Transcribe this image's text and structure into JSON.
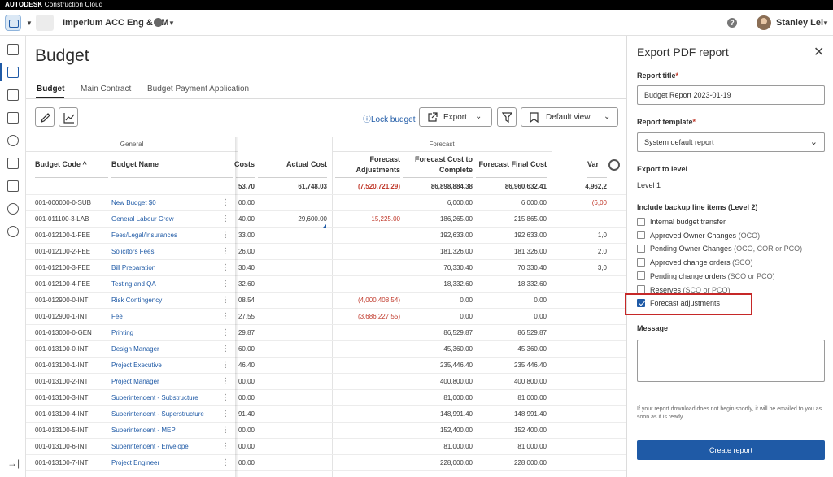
{
  "brand": {
    "name": "AUTODESK",
    "product": "Construction Cloud"
  },
  "header": {
    "project_name": "Imperium ACC Eng & PM",
    "user_name": "Stanley Lei",
    "help": "?"
  },
  "page": {
    "title": "Budget"
  },
  "tabs": [
    "Budget",
    "Main Contract",
    "Budget Payment Application"
  ],
  "toolbar": {
    "lock_budget": "Lock budget",
    "export": "Export",
    "view": "Default view"
  },
  "table": {
    "groups": {
      "general": "General",
      "forecast": "Forecast"
    },
    "columns": {
      "code": "Budget Code",
      "name": "Budget Name",
      "costs": "Costs",
      "actual": "Actual Cost",
      "fc_adj": "Forecast Adjustments",
      "fc_complete": "Forecast Cost to Complete",
      "fc_final": "Forecast Final Cost",
      "var": "Var"
    },
    "totals": {
      "costs": "53.70",
      "actual": "61,748.03",
      "fc_adj": "(7,520,721.29)",
      "fc_complete": "86,898,884.38",
      "fc_final": "86,960,632.41",
      "var": "4,962,2"
    },
    "rows": [
      {
        "code": "001-000000-0-SUB",
        "name": "New Budget $0",
        "costs": "00.00",
        "actual": "",
        "fc_adj": "",
        "fc_complete": "6,000.00",
        "fc_final": "6,000.00",
        "var": "(6,00"
      },
      {
        "code": "001-011100-3-LAB",
        "name": "General Labour Crew",
        "costs": "40.00",
        "actual": "29,600.00",
        "fc_adj": "15,225.00",
        "fc_complete": "186,265.00",
        "fc_final": "215,865.00",
        "var": ""
      },
      {
        "code": "001-012100-1-FEE",
        "name": "Fees/Legal/Insurances",
        "costs": "33.00",
        "actual": "",
        "fc_adj": "",
        "fc_complete": "192,633.00",
        "fc_final": "192,633.00",
        "var": "1,0"
      },
      {
        "code": "001-012100-2-FEE",
        "name": "Solicitors Fees",
        "costs": "26.00",
        "actual": "",
        "fc_adj": "",
        "fc_complete": "181,326.00",
        "fc_final": "181,326.00",
        "var": "2,0"
      },
      {
        "code": "001-012100-3-FEE",
        "name": "Bill Preparation",
        "costs": "30.40",
        "actual": "",
        "fc_adj": "",
        "fc_complete": "70,330.40",
        "fc_final": "70,330.40",
        "var": "3,0"
      },
      {
        "code": "001-012100-4-FEE",
        "name": "Testing and QA",
        "costs": "32.60",
        "actual": "",
        "fc_adj": "",
        "fc_complete": "18,332.60",
        "fc_final": "18,332.60",
        "var": ""
      },
      {
        "code": "001-012900-0-INT",
        "name": "Risk Contingency",
        "costs": "08.54",
        "actual": "",
        "fc_adj": "(4,000,408.54)",
        "fc_complete": "0.00",
        "fc_final": "0.00",
        "var": ""
      },
      {
        "code": "001-012900-1-INT",
        "name": "Fee",
        "costs": "27.55",
        "actual": "",
        "fc_adj": "(3,686,227.55)",
        "fc_complete": "0.00",
        "fc_final": "0.00",
        "var": ""
      },
      {
        "code": "001-013000-0-GEN",
        "name": "Printing",
        "costs": "29.87",
        "actual": "",
        "fc_adj": "",
        "fc_complete": "86,529.87",
        "fc_final": "86,529.87",
        "var": ""
      },
      {
        "code": "001-013100-0-INT",
        "name": "Design Manager",
        "costs": "60.00",
        "actual": "",
        "fc_adj": "",
        "fc_complete": "45,360.00",
        "fc_final": "45,360.00",
        "var": ""
      },
      {
        "code": "001-013100-1-INT",
        "name": "Project Executive",
        "costs": "46.40",
        "actual": "",
        "fc_adj": "",
        "fc_complete": "235,446.40",
        "fc_final": "235,446.40",
        "var": ""
      },
      {
        "code": "001-013100-2-INT",
        "name": "Project Manager",
        "costs": "00.00",
        "actual": "",
        "fc_adj": "",
        "fc_complete": "400,800.00",
        "fc_final": "400,800.00",
        "var": ""
      },
      {
        "code": "001-013100-3-INT",
        "name": "Superintendent - Substructure",
        "costs": "00.00",
        "actual": "",
        "fc_adj": "",
        "fc_complete": "81,000.00",
        "fc_final": "81,000.00",
        "var": ""
      },
      {
        "code": "001-013100-4-INT",
        "name": "Superintendent - Superstructure",
        "costs": "91.40",
        "actual": "",
        "fc_adj": "",
        "fc_complete": "148,991.40",
        "fc_final": "148,991.40",
        "var": ""
      },
      {
        "code": "001-013100-5-INT",
        "name": "Superintendent - MEP",
        "costs": "00.00",
        "actual": "",
        "fc_adj": "",
        "fc_complete": "152,400.00",
        "fc_final": "152,400.00",
        "var": ""
      },
      {
        "code": "001-013100-6-INT",
        "name": "Superintendent - Envelope",
        "costs": "00.00",
        "actual": "",
        "fc_adj": "",
        "fc_complete": "81,000.00",
        "fc_final": "81,000.00",
        "var": ""
      },
      {
        "code": "001-013100-7-INT",
        "name": "Project Engineer",
        "costs": "00.00",
        "actual": "",
        "fc_adj": "",
        "fc_complete": "228,000.00",
        "fc_final": "228,000.00",
        "var": ""
      }
    ]
  },
  "panel": {
    "title": "Export PDF report",
    "report_title_label": "Report title",
    "report_title_value": "Budget Report 2023-01-19",
    "template_label": "Report template",
    "template_value": "System default report",
    "export_level_label": "Export to level",
    "export_level_value": "Level 1",
    "backup_label": "Include backup line items (Level 2)",
    "options": [
      {
        "label": "Internal budget transfer",
        "extra": "",
        "checked": false
      },
      {
        "label": "Approved Owner Changes",
        "extra": "(OCO)",
        "checked": false
      },
      {
        "label": "Pending Owner Changes",
        "extra": "(OCO, COR or PCO)",
        "checked": false
      },
      {
        "label": "Approved change orders",
        "extra": "(SCO)",
        "checked": false
      },
      {
        "label": "Pending change orders",
        "extra": "(SCO or PCO)",
        "checked": false
      },
      {
        "label": "Reserves",
        "extra": "(SCO or PCO)",
        "checked": false
      },
      {
        "label": "Forecast adjustments",
        "extra": "",
        "checked": true
      }
    ],
    "message_label": "Message",
    "note": "If your report download does not begin shortly, it will be emailed to you as soon as it is ready.",
    "submit": "Create report"
  },
  "colors": {
    "accent": "#1f5aa6",
    "negative": "#c0392b",
    "highlight": "#c62828"
  }
}
